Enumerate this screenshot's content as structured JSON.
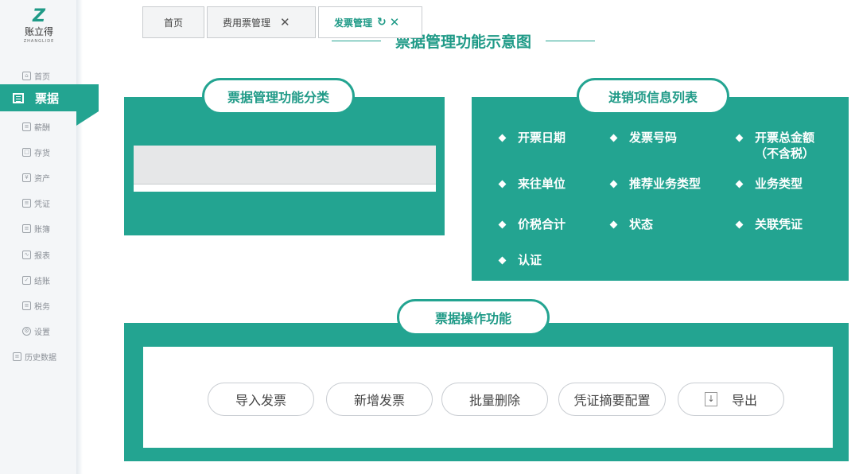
{
  "sidebar": {
    "logo_mark": "Z",
    "logo_text": "账立得",
    "logo_sub": "ZHANGLIDE",
    "items": [
      {
        "label": "首页",
        "icon": "home-icon"
      },
      {
        "label": "票据",
        "icon": "document-icon",
        "active": true
      },
      {
        "label": "薪酬",
        "icon": "calendar-icon"
      },
      {
        "label": "存货",
        "icon": "box-icon"
      },
      {
        "label": "资产",
        "icon": "asset-icon"
      },
      {
        "label": "凭证",
        "icon": "voucher-icon"
      },
      {
        "label": "账簿",
        "icon": "book-icon"
      },
      {
        "label": "报表",
        "icon": "chart-icon"
      },
      {
        "label": "结账",
        "icon": "checkout-icon"
      },
      {
        "label": "税务",
        "icon": "tax-icon"
      },
      {
        "label": "设置",
        "icon": "gear-icon"
      },
      {
        "label": "历史数据",
        "icon": "history-icon"
      }
    ]
  },
  "main_title": "票据管理功能示意图",
  "category_panel": {
    "title": "票据管理功能分类",
    "tabs": [
      {
        "label": "首页",
        "closable": false
      },
      {
        "label": "费用票管理",
        "closable": true
      },
      {
        "label": "发票管理",
        "closable": true,
        "active": true
      }
    ],
    "close_glyph": "✕",
    "refresh_glyph": "↻"
  },
  "info_panel": {
    "title": "进销项信息列表",
    "items": [
      {
        "label": "开票日期",
        "second": ""
      },
      {
        "label": "发票号码",
        "second": ""
      },
      {
        "label": "开票总金额",
        "second": "（不含税）"
      },
      {
        "label": "来往单位",
        "second": ""
      },
      {
        "label": "推荐业务类型",
        "second": ""
      },
      {
        "label": "业务类型",
        "second": ""
      },
      {
        "label": "价税合计",
        "second": ""
      },
      {
        "label": "状态",
        "second": ""
      },
      {
        "label": "关联凭证",
        "second": ""
      },
      {
        "label": "认证",
        "second": ""
      }
    ]
  },
  "ops_panel": {
    "title": "票据操作功能",
    "buttons": [
      {
        "label": "导入发票"
      },
      {
        "label": "新增发票"
      },
      {
        "label": "批量删除"
      },
      {
        "label": "凭证摘要配置"
      },
      {
        "label": "导出",
        "icon": "download-icon",
        "icon_glyph": "↓"
      }
    ]
  },
  "colors": {
    "accent": "#23a491",
    "accent_text": "#1f9a87",
    "sidebar_bg": "#f4f6f8"
  }
}
